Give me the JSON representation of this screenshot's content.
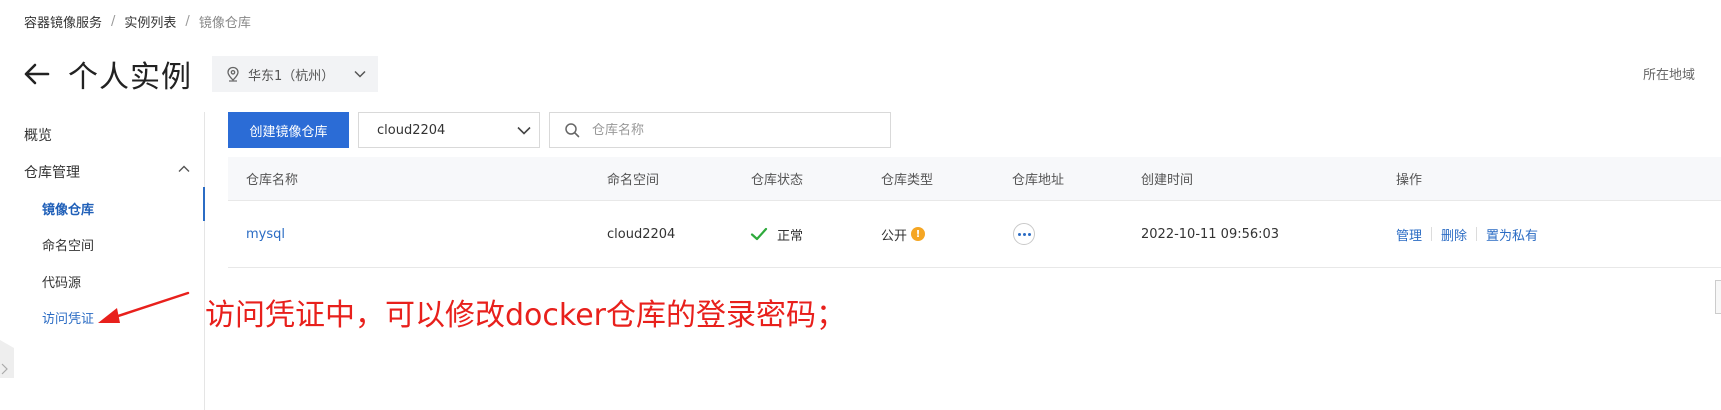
{
  "breadcrumb": [
    {
      "label": "容器镜像服务"
    },
    {
      "label": "实例列表"
    },
    {
      "label": "镜像仓库"
    }
  ],
  "breadcrumb_sep": "/",
  "header": {
    "title": "个人实例",
    "region": "华东1（杭州）",
    "region_right": "所在地域"
  },
  "sidebar": {
    "overview": "概览",
    "repo_mgmt": "仓库管理",
    "items": [
      {
        "label": "镜像仓库",
        "active": true
      },
      {
        "label": "命名空间"
      },
      {
        "label": "代码源"
      },
      {
        "label": "访问凭证"
      }
    ]
  },
  "toolbar": {
    "create_label": "创建镜像仓库",
    "namespace_value": "cloud2204",
    "search_placeholder": "仓库名称"
  },
  "table": {
    "columns": [
      "仓库名称",
      "命名空间",
      "仓库状态",
      "仓库类型",
      "仓库地址",
      "创建时间",
      "操作"
    ],
    "rows": [
      {
        "name": "mysql",
        "namespace": "cloud2204",
        "status": "正常",
        "type": "公开",
        "created": "2022-10-11 09:56:03",
        "ops": [
          "管理",
          "删除",
          "置为私有"
        ]
      }
    ]
  },
  "annotation": "访问凭证中，可以修改docker仓库的登录密码；",
  "colors": {
    "primary": "#2b6cd6",
    "link": "#2b6cc4",
    "annotation": "#e8201c",
    "ok": "#2eaa3c",
    "warn": "#f5a623"
  },
  "icons": [
    "back-arrow-icon",
    "location-pin-icon",
    "chevron-down-icon",
    "chevron-up-icon",
    "search-icon",
    "check-icon",
    "warning-icon",
    "more-icon"
  ]
}
